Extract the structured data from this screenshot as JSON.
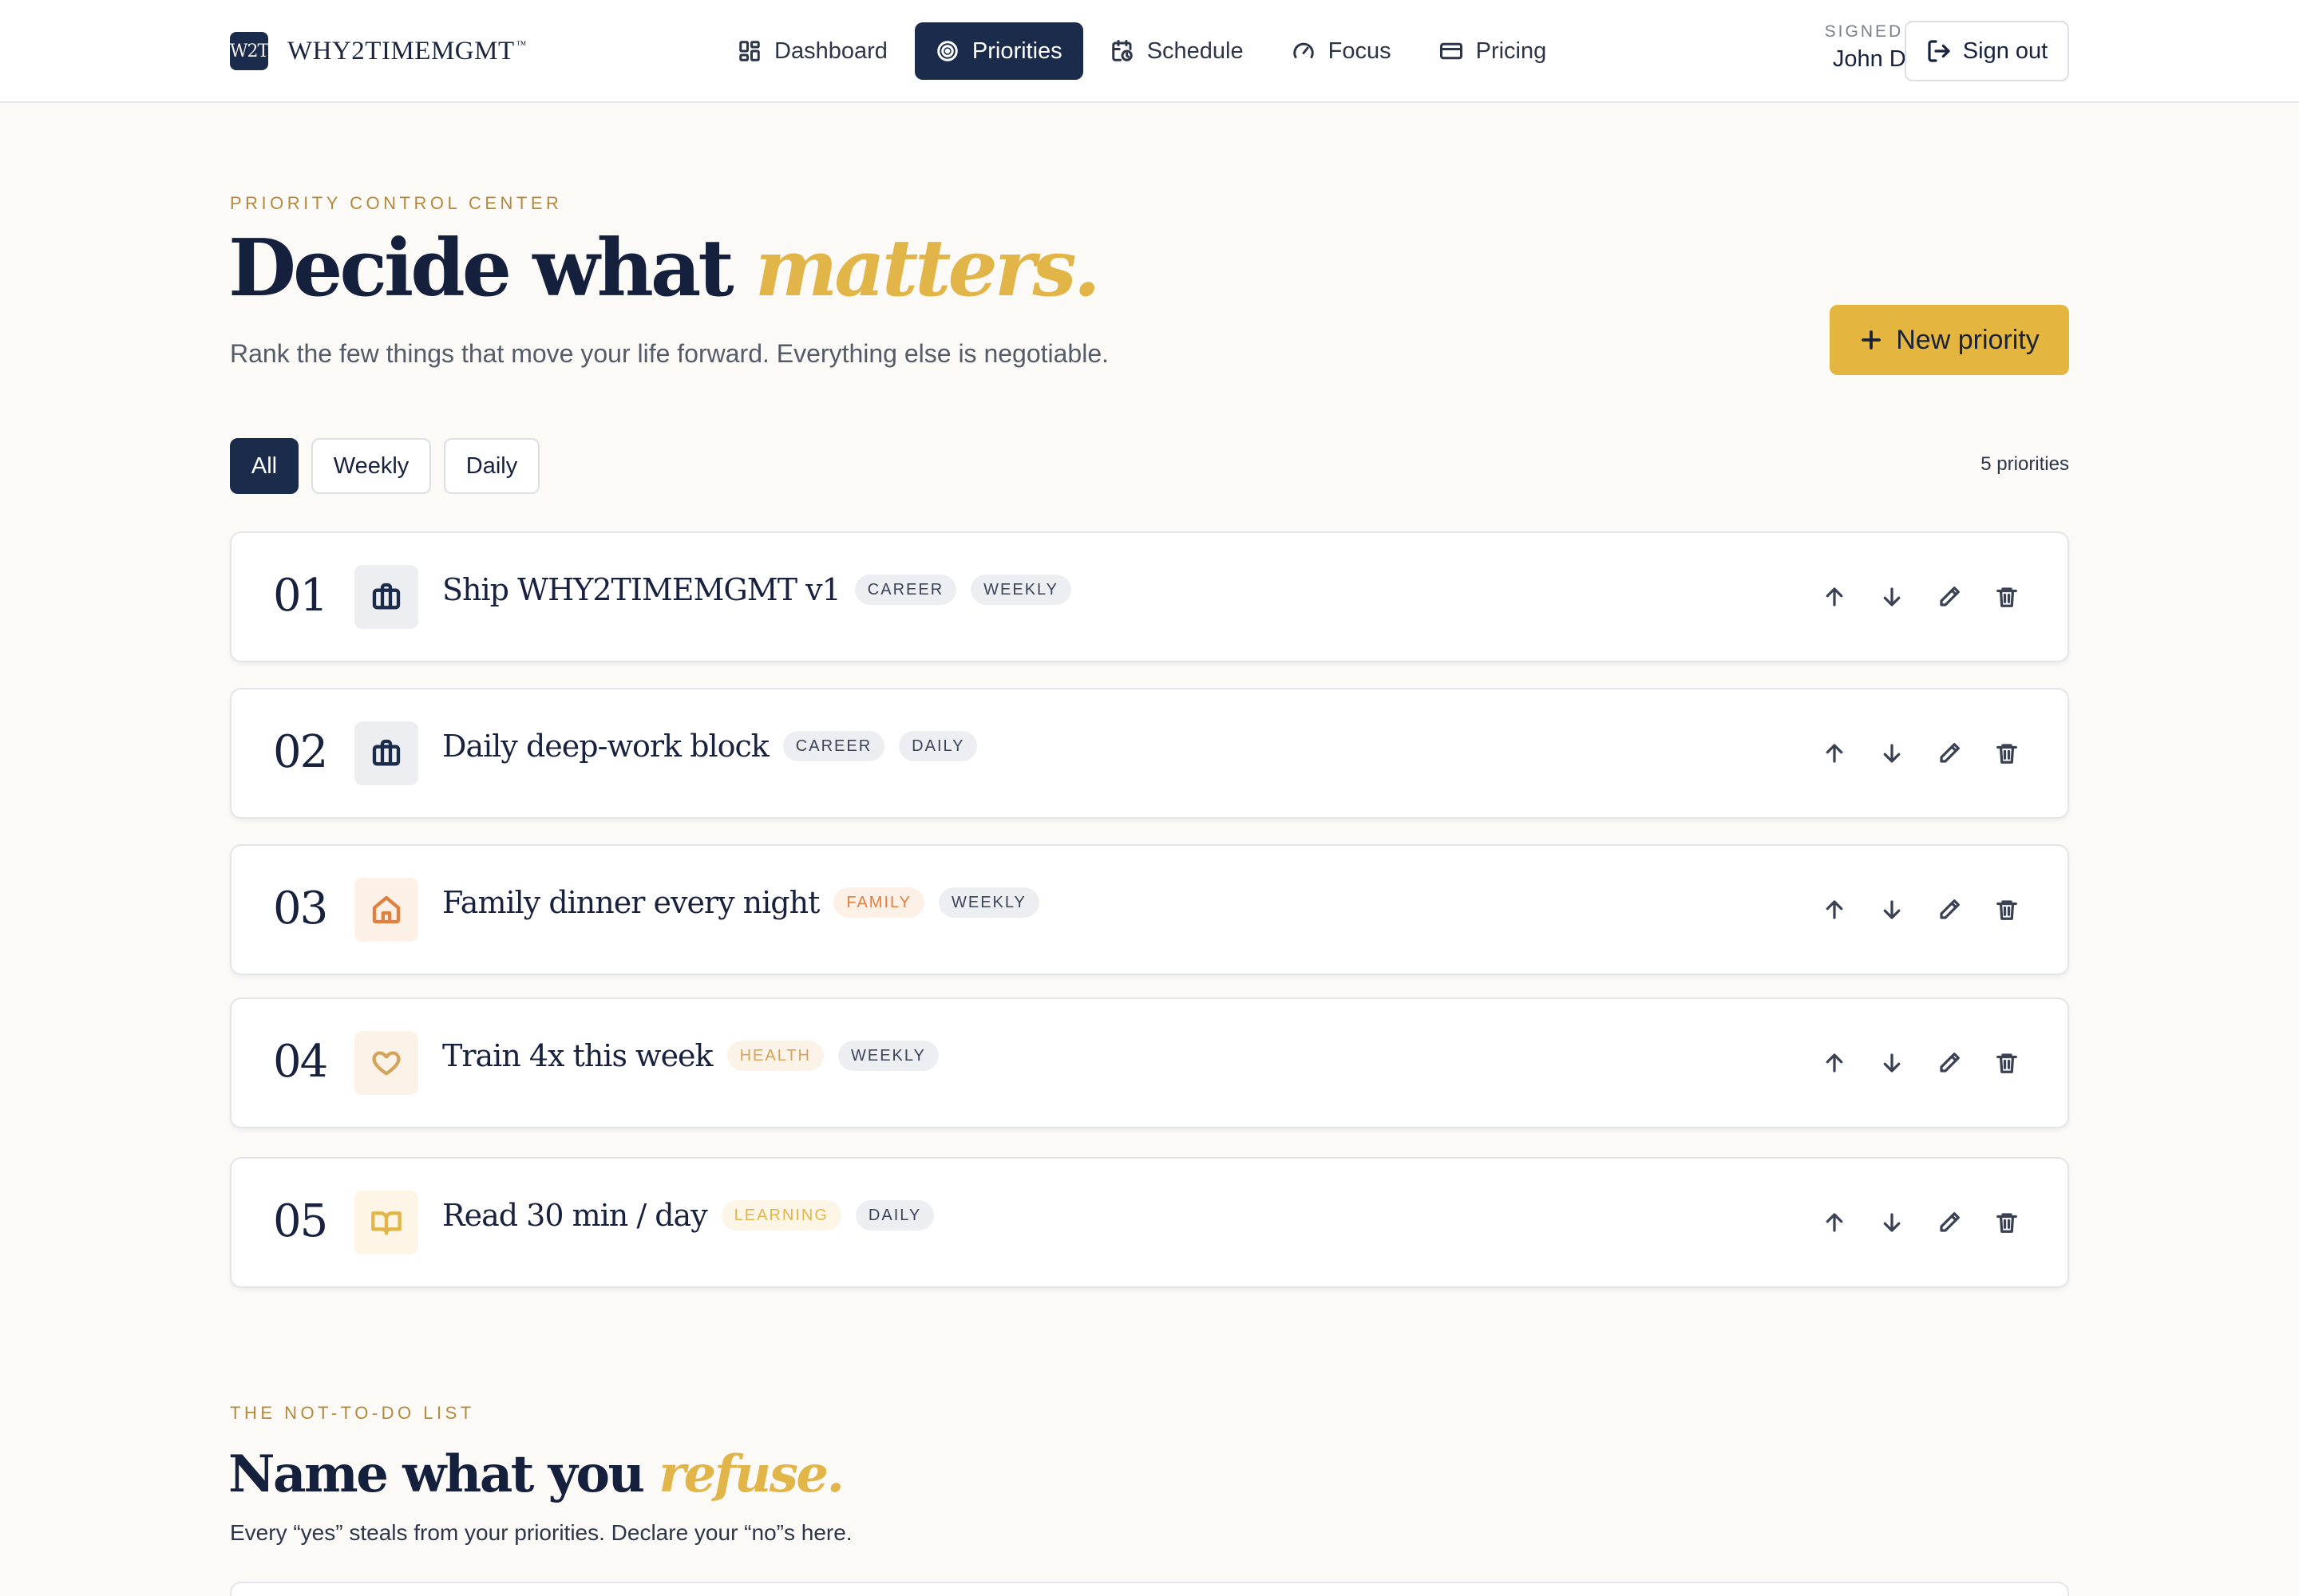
{
  "header": {
    "logo_text": "W2T",
    "brand": "WHY2TIMEMGMT",
    "trademark": "™",
    "nav": [
      {
        "label": "Dashboard",
        "icon": "dashboard-grid-icon"
      },
      {
        "label": "Priorities",
        "icon": "target-icon",
        "active": true
      },
      {
        "label": "Schedule",
        "icon": "calendar-clock-icon"
      },
      {
        "label": "Focus",
        "icon": "gauge-icon"
      },
      {
        "label": "Pricing",
        "icon": "credit-card-icon"
      }
    ],
    "signed_in_label": "SIGNED IN",
    "user_name": "John Doe",
    "signout_label": "Sign out"
  },
  "hero": {
    "eyebrow": "PRIORITY CONTROL CENTER",
    "title_plain": "Decide what ",
    "title_accent": "matters.",
    "subtitle": "Rank the few things that move your life forward. Everything else is negotiable.",
    "new_button": "New priority"
  },
  "filters": {
    "options": [
      "All",
      "Weekly",
      "Daily"
    ],
    "selected": "All",
    "count_text": "5 priorities"
  },
  "priorities": [
    {
      "rank": "01",
      "title": "Ship WHY2TIMEMGMT v1",
      "category": "CAREER",
      "cadence": "WEEKLY",
      "icon": "briefcase-icon"
    },
    {
      "rank": "02",
      "title": "Daily deep-work block",
      "category": "CAREER",
      "cadence": "DAILY",
      "icon": "briefcase-icon"
    },
    {
      "rank": "03",
      "title": "Family dinner every night",
      "category": "FAMILY",
      "cadence": "WEEKLY",
      "icon": "home-icon"
    },
    {
      "rank": "04",
      "title": "Train 4x this week",
      "category": "HEALTH",
      "cadence": "WEEKLY",
      "icon": "heart-icon"
    },
    {
      "rank": "05",
      "title": "Read 30 min / day",
      "category": "LEARNING",
      "cadence": "DAILY",
      "icon": "book-icon"
    }
  ],
  "not_to_do": {
    "eyebrow": "THE NOT-TO-DO LIST",
    "title_plain": "Name what you ",
    "title_accent": "refuse.",
    "subtitle": "Every “yes” steals from your priorities. Declare your “no”s here."
  },
  "colors": {
    "navy": "#1b2b4b",
    "gold": "#e4b63f",
    "gold_text": "#b5893d",
    "background": "#fbfaf7",
    "career_bg": "#eceef2",
    "career_fg": "#3c4356",
    "family_bg": "#fdf0e7",
    "family_fg": "#e0803f",
    "health_bg": "#fbf3e8",
    "health_fg": "#d3a55c",
    "learning_bg": "#fdf6e6",
    "learning_fg": "#e2b54a"
  }
}
